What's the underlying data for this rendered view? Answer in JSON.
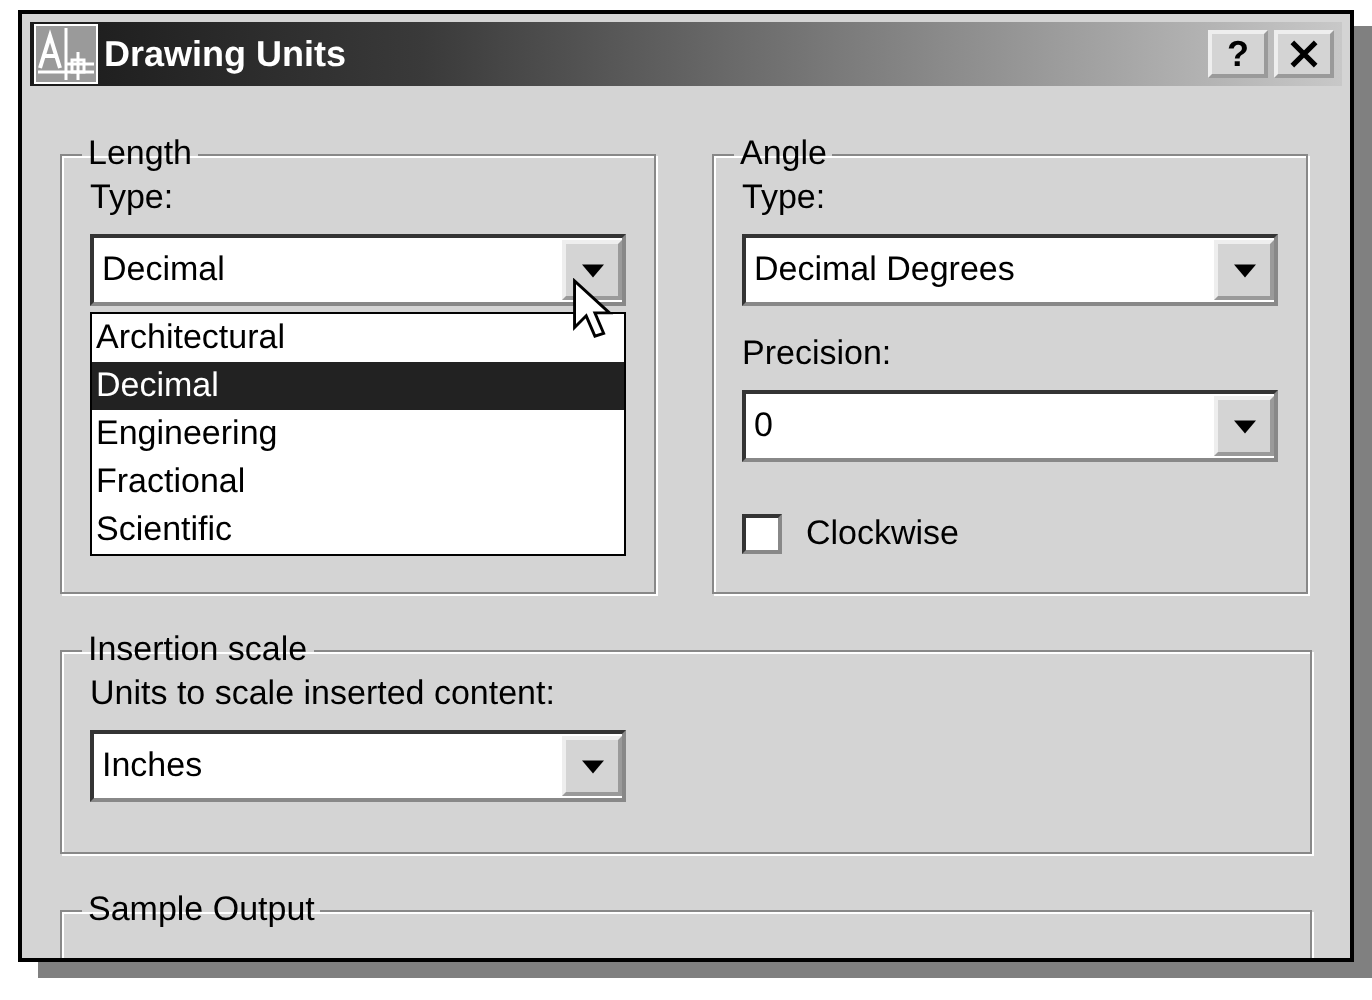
{
  "window": {
    "title": "Drawing Units",
    "help_button": "?"
  },
  "length": {
    "legend": "Length",
    "type_label": "Type:",
    "type_value": "Decimal",
    "options": [
      {
        "label": "Architectural",
        "selected": false
      },
      {
        "label": "Decimal",
        "selected": true
      },
      {
        "label": "Engineering",
        "selected": false
      },
      {
        "label": "Fractional",
        "selected": false
      },
      {
        "label": "Scientific",
        "selected": false
      }
    ]
  },
  "angle": {
    "legend": "Angle",
    "type_label": "Type:",
    "type_value": "Decimal Degrees",
    "precision_label": "Precision:",
    "precision_value": "0",
    "clockwise": {
      "label": "Clockwise",
      "checked": false
    }
  },
  "insertion_scale": {
    "legend": "Insertion scale",
    "label": "Units to scale inserted content:",
    "value": "Inches"
  },
  "sample_output": {
    "legend": "Sample Output"
  }
}
